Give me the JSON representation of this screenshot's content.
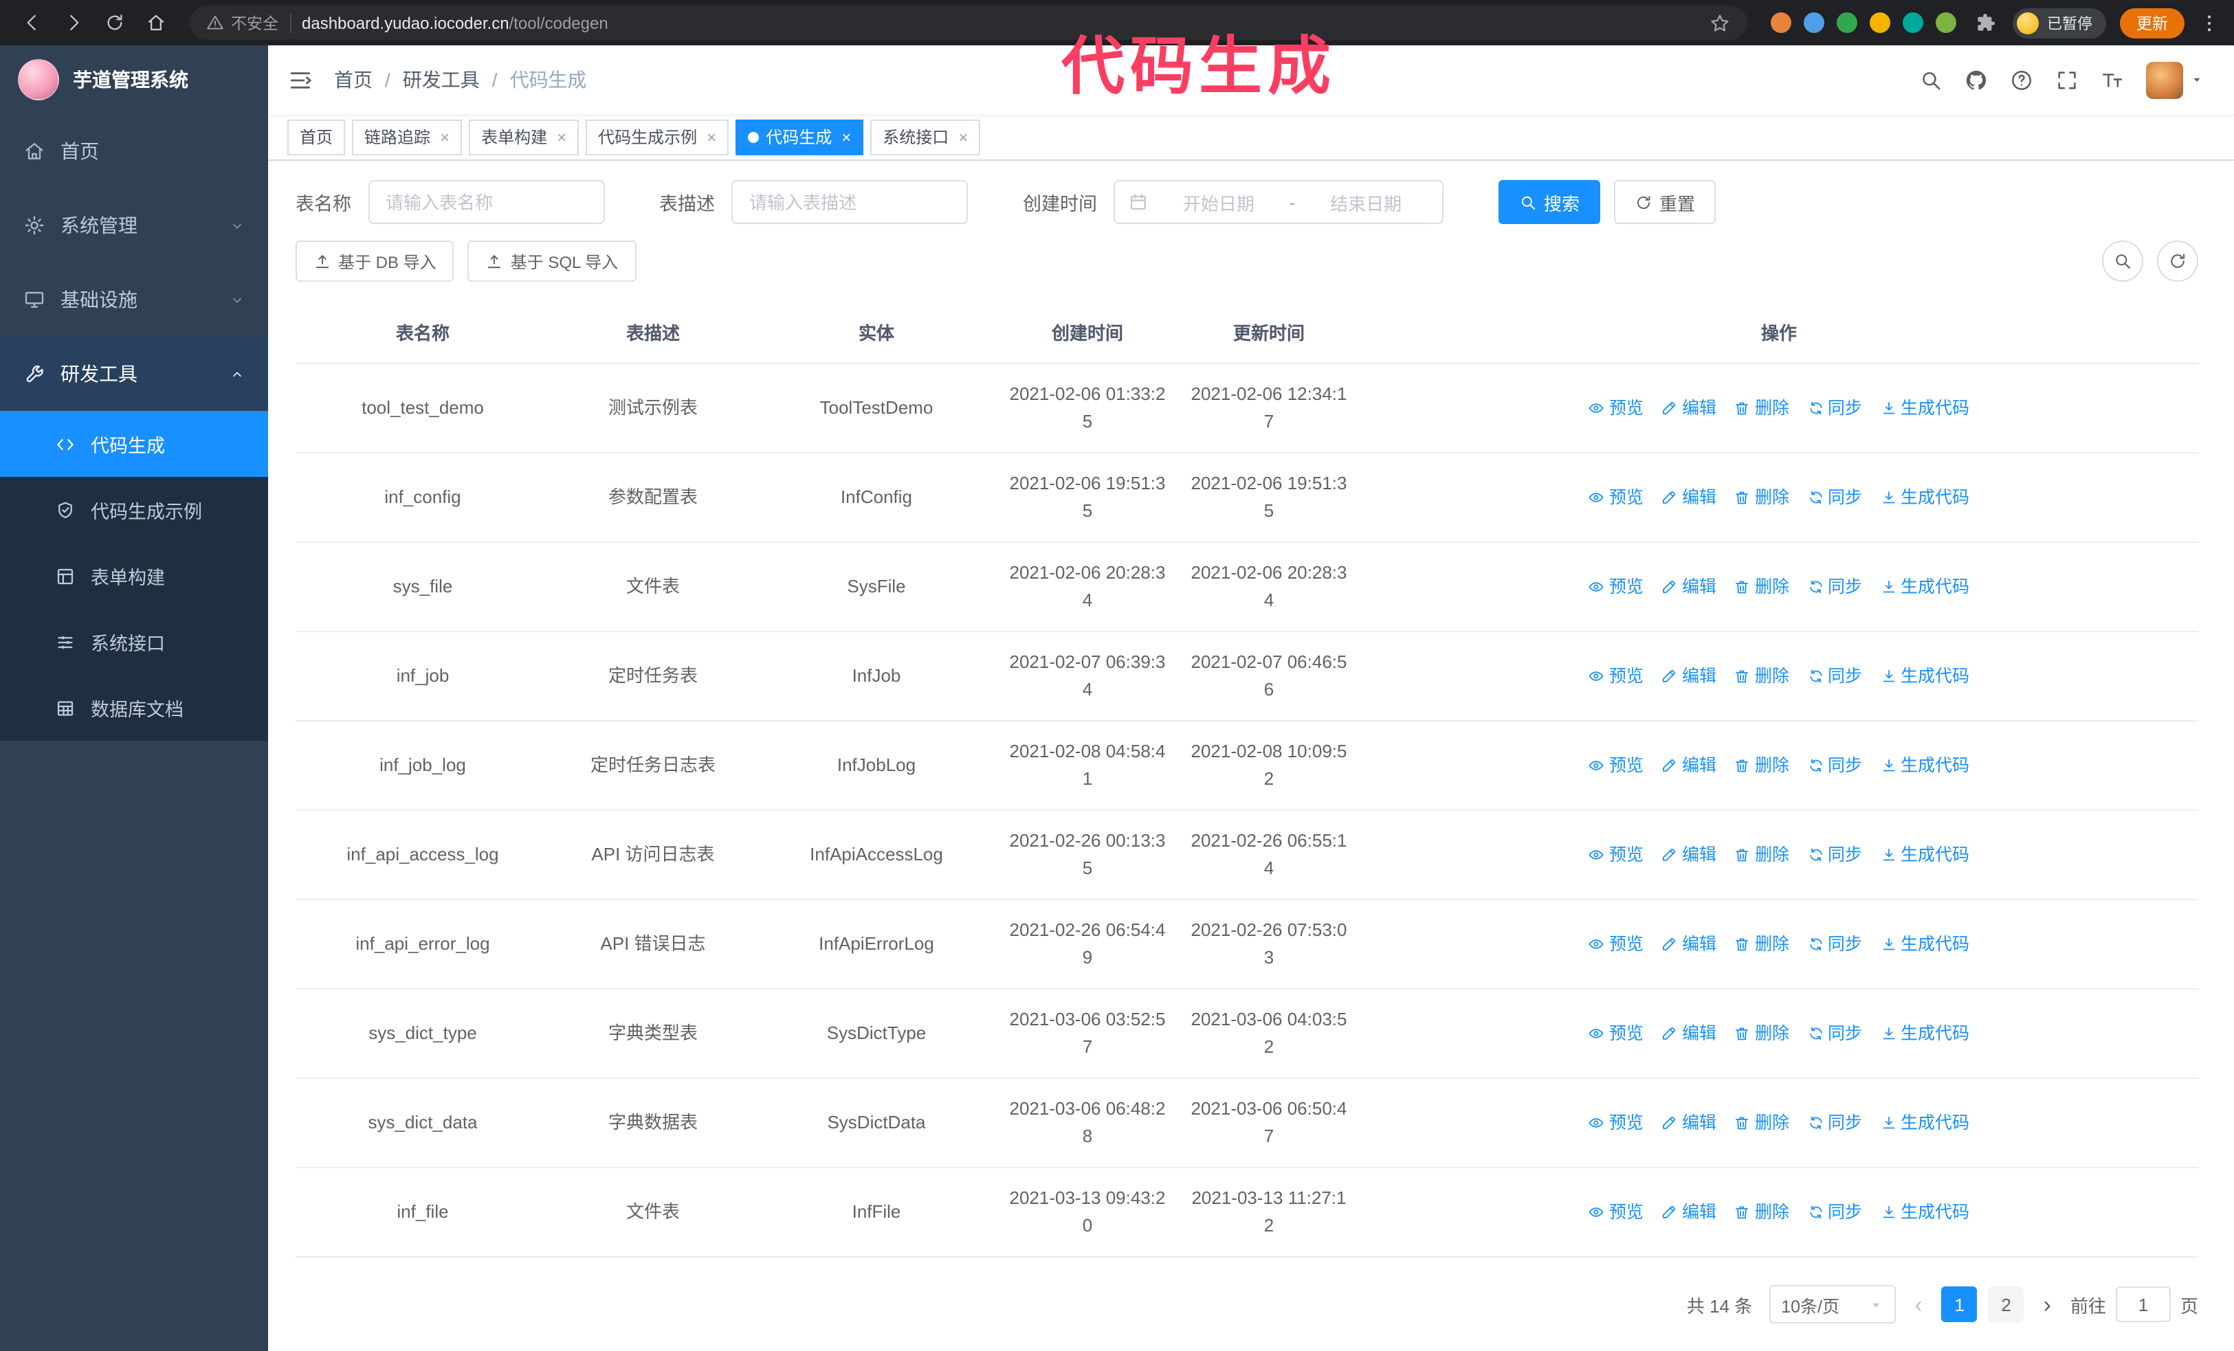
{
  "annotation": {
    "text": "代码生成"
  },
  "colors": {
    "accent": "#1890ff",
    "sidebar_bg": "#304156",
    "submenu_bg": "#202f3f",
    "active_menu_bg": "#1890ff",
    "annotation": "#fa3e62",
    "update_button_bg": "#e8710a",
    "browser_bar_bg": "#202124"
  },
  "browser": {
    "security_label": "不安全",
    "url_host": "dashboard.yudao.iocoder.cn",
    "url_path": "/tool/codegen",
    "extension_colors": [
      "#e8833a",
      "#4f9ee8",
      "#31a84f",
      "#f4b400",
      "#00a99d",
      "#7cb342"
    ],
    "paused_badge": "已暂停",
    "update_button": "更新"
  },
  "sidebar": {
    "logo_title": "芋道管理系统",
    "items": [
      {
        "id": "home",
        "label": "首页",
        "icon": "home",
        "chevron": false
      },
      {
        "id": "system",
        "label": "系统管理",
        "icon": "gear",
        "chevron": true
      },
      {
        "id": "infra",
        "label": "基础设施",
        "icon": "infra",
        "chevron": true
      },
      {
        "id": "dev-tools",
        "label": "研发工具",
        "icon": "tool",
        "chevron": true,
        "expanded": true
      }
    ],
    "sub_items": [
      {
        "id": "codegen",
        "label": "代码生成",
        "icon": "code",
        "active": true
      },
      {
        "id": "codegen-example",
        "label": "代码生成示例",
        "icon": "shield"
      },
      {
        "id": "form-builder",
        "label": "表单构建",
        "icon": "formgrid"
      },
      {
        "id": "system-api",
        "label": "系统接口",
        "icon": "sliders"
      },
      {
        "id": "db-doc",
        "label": "数据库文档",
        "icon": "dbdoc"
      }
    ]
  },
  "header": {
    "breadcrumb": [
      "首页",
      "研发工具",
      "代码生成"
    ],
    "separator": "/"
  },
  "tabs": [
    {
      "label": "首页",
      "closable": false
    },
    {
      "label": "链路追踪",
      "closable": true
    },
    {
      "label": "表单构建",
      "closable": true
    },
    {
      "label": "代码生成示例",
      "closable": true
    },
    {
      "label": "代码生成",
      "closable": true,
      "active": true
    },
    {
      "label": "系统接口",
      "closable": true
    }
  ],
  "filters": {
    "table_name_label": "表名称",
    "table_name_placeholder": "请输入表名称",
    "table_desc_label": "表描述",
    "table_desc_placeholder": "请输入表描述",
    "create_time_label": "创建时间",
    "date_start_placeholder": "开始日期",
    "date_separator": "-",
    "date_end_placeholder": "结束日期",
    "search_button": "搜索",
    "reset_button": "重置"
  },
  "toolbar": {
    "import_db_button": "基于 DB 导入",
    "import_sql_button": "基于 SQL 导入"
  },
  "table": {
    "columns": [
      "表名称",
      "表描述",
      "实体",
      "创建时间",
      "更新时间",
      "操作"
    ],
    "actions": [
      "预览",
      "编辑",
      "删除",
      "同步",
      "生成代码"
    ],
    "rows": [
      {
        "name": "tool_test_demo",
        "desc": "测试示例表",
        "entity": "ToolTestDemo",
        "created": "2021-02-06 01:33:25",
        "updated": "2021-02-06 12:34:17"
      },
      {
        "name": "inf_config",
        "desc": "参数配置表",
        "entity": "InfConfig",
        "created": "2021-02-06 19:51:35",
        "updated": "2021-02-06 19:51:35"
      },
      {
        "name": "sys_file",
        "desc": "文件表",
        "entity": "SysFile",
        "created": "2021-02-06 20:28:34",
        "updated": "2021-02-06 20:28:34"
      },
      {
        "name": "inf_job",
        "desc": "定时任务表",
        "entity": "InfJob",
        "created": "2021-02-07 06:39:34",
        "updated": "2021-02-07 06:46:56"
      },
      {
        "name": "inf_job_log",
        "desc": "定时任务日志表",
        "entity": "InfJobLog",
        "created": "2021-02-08 04:58:41",
        "updated": "2021-02-08 10:09:52"
      },
      {
        "name": "inf_api_access_log",
        "desc": "API 访问日志表",
        "entity": "InfApiAccessLog",
        "created": "2021-02-26 00:13:35",
        "updated": "2021-02-26 06:55:14"
      },
      {
        "name": "inf_api_error_log",
        "desc": "API 错误日志",
        "entity": "InfApiErrorLog",
        "created": "2021-02-26 06:54:49",
        "updated": "2021-02-26 07:53:03"
      },
      {
        "name": "sys_dict_type",
        "desc": "字典类型表",
        "entity": "SysDictType",
        "created": "2021-03-06 03:52:57",
        "updated": "2021-03-06 04:03:52"
      },
      {
        "name": "sys_dict_data",
        "desc": "字典数据表",
        "entity": "SysDictData",
        "created": "2021-03-06 06:48:28",
        "updated": "2021-03-06 06:50:47"
      },
      {
        "name": "inf_file",
        "desc": "文件表",
        "entity": "InfFile",
        "created": "2021-03-13 09:43:20",
        "updated": "2021-03-13 11:27:12"
      }
    ]
  },
  "pagination": {
    "total_text": "共 14 条",
    "page_size_label": "10条/页",
    "pages": [
      {
        "label": "1",
        "active": true
      },
      {
        "label": "2",
        "active": false
      }
    ],
    "goto_label": "前往",
    "goto_value": "1",
    "goto_unit": "页"
  }
}
